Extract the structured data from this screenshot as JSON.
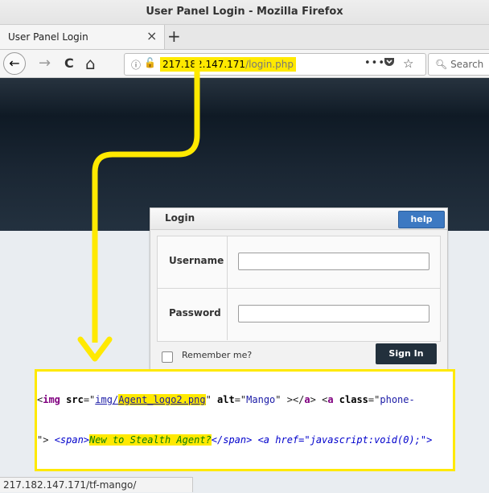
{
  "window": {
    "title": "User Panel Login - Mozilla Firefox"
  },
  "tab": {
    "title": "User Panel Login",
    "close_glyph": "×",
    "new_tab_glyph": "+"
  },
  "nav": {
    "back_glyph": "←",
    "forward_glyph": "→",
    "reload_glyph": "C",
    "home_glyph": "⌂",
    "url_host": "217.182.147.171",
    "url_path": "/login.php",
    "page_actions_glyph": "•••",
    "search_placeholder": "Search"
  },
  "login": {
    "panel_title": "Login",
    "help_label": "help",
    "username_label": "Username",
    "password_label": "Password",
    "remember_label": "Remember me?",
    "signin_label": "Sign In"
  },
  "callout": {
    "line1": {
      "open": "<",
      "tag": "img",
      "src_attr": " src",
      "eq1": "=\"",
      "src_prefix": "img/",
      "src_file": "Agent_logo2.png",
      "close_q1": "\"",
      "alt_attr": " alt",
      "eq2": "=\"",
      "alt_val": "Mango",
      "rest1": "\" ></",
      "a_tag": "a",
      "rest2": "> <",
      "a_tag2": "a",
      "class_attr": " class",
      "eq3": "=\"",
      "class_val": "phone-"
    },
    "line2": {
      "start": "\"> ",
      "span_open": "<span>",
      "highlight": "New to Stealth Agent?",
      "span_close": "</span>",
      "space": " ",
      "a_open": "<a href=\"javascript:void(0);\">"
    }
  },
  "status": {
    "url": "217.182.147.171/tf-mango/"
  },
  "colors": {
    "highlight": "#ffe900",
    "help_button": "#3d79c2",
    "signin_button": "#22303c"
  }
}
